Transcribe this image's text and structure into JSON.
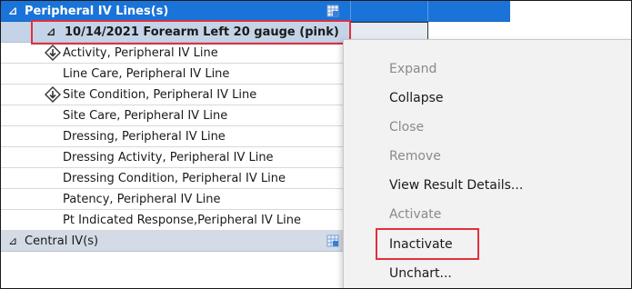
{
  "rows": [
    {
      "label": "Peripheral IV Lines(s)",
      "kind": "section"
    },
    {
      "label": "10/14/2021 Forearm Left 20 gauge (pink)",
      "kind": "subsection"
    },
    {
      "label": "Activity, Peripheral IV Line",
      "icon": "diamond-down-arrow-icon"
    },
    {
      "label": "Line Care, Peripheral IV Line"
    },
    {
      "label": "Site Condition, Peripheral IV Line",
      "icon": "diamond-down-arrow-icon"
    },
    {
      "label": "Site Care, Peripheral IV Line"
    },
    {
      "label": "Dressing, Peripheral IV Line"
    },
    {
      "label": "Dressing Activity, Peripheral IV Line"
    },
    {
      "label": "Dressing Condition, Peripheral IV Line"
    },
    {
      "label": "Patency, Peripheral IV Line"
    },
    {
      "label": "Pt Indicated Response,Peripheral IV Line"
    },
    {
      "label": "Central IV(s)",
      "kind": "section-grey"
    }
  ],
  "section_glyph": "⊿",
  "context_menu": {
    "items": [
      {
        "label": "Expand",
        "enabled": false
      },
      {
        "label": "Collapse",
        "enabled": true
      },
      {
        "label": "Close",
        "enabled": false
      },
      {
        "label": "Remove",
        "enabled": false
      },
      {
        "label": "View Result Details...",
        "enabled": true
      },
      {
        "label": "Activate",
        "enabled": false
      },
      {
        "label": "Inactivate",
        "enabled": true,
        "highlighted": true
      },
      {
        "label": "Unchart...",
        "enabled": true
      }
    ]
  },
  "colors": {
    "section_header": "#1a73d9",
    "subsection_header": "#c5d3e8",
    "highlight_box": "#e0303c",
    "menu_background": "#f2f2f2",
    "disabled_text": "#8a8a8a"
  }
}
